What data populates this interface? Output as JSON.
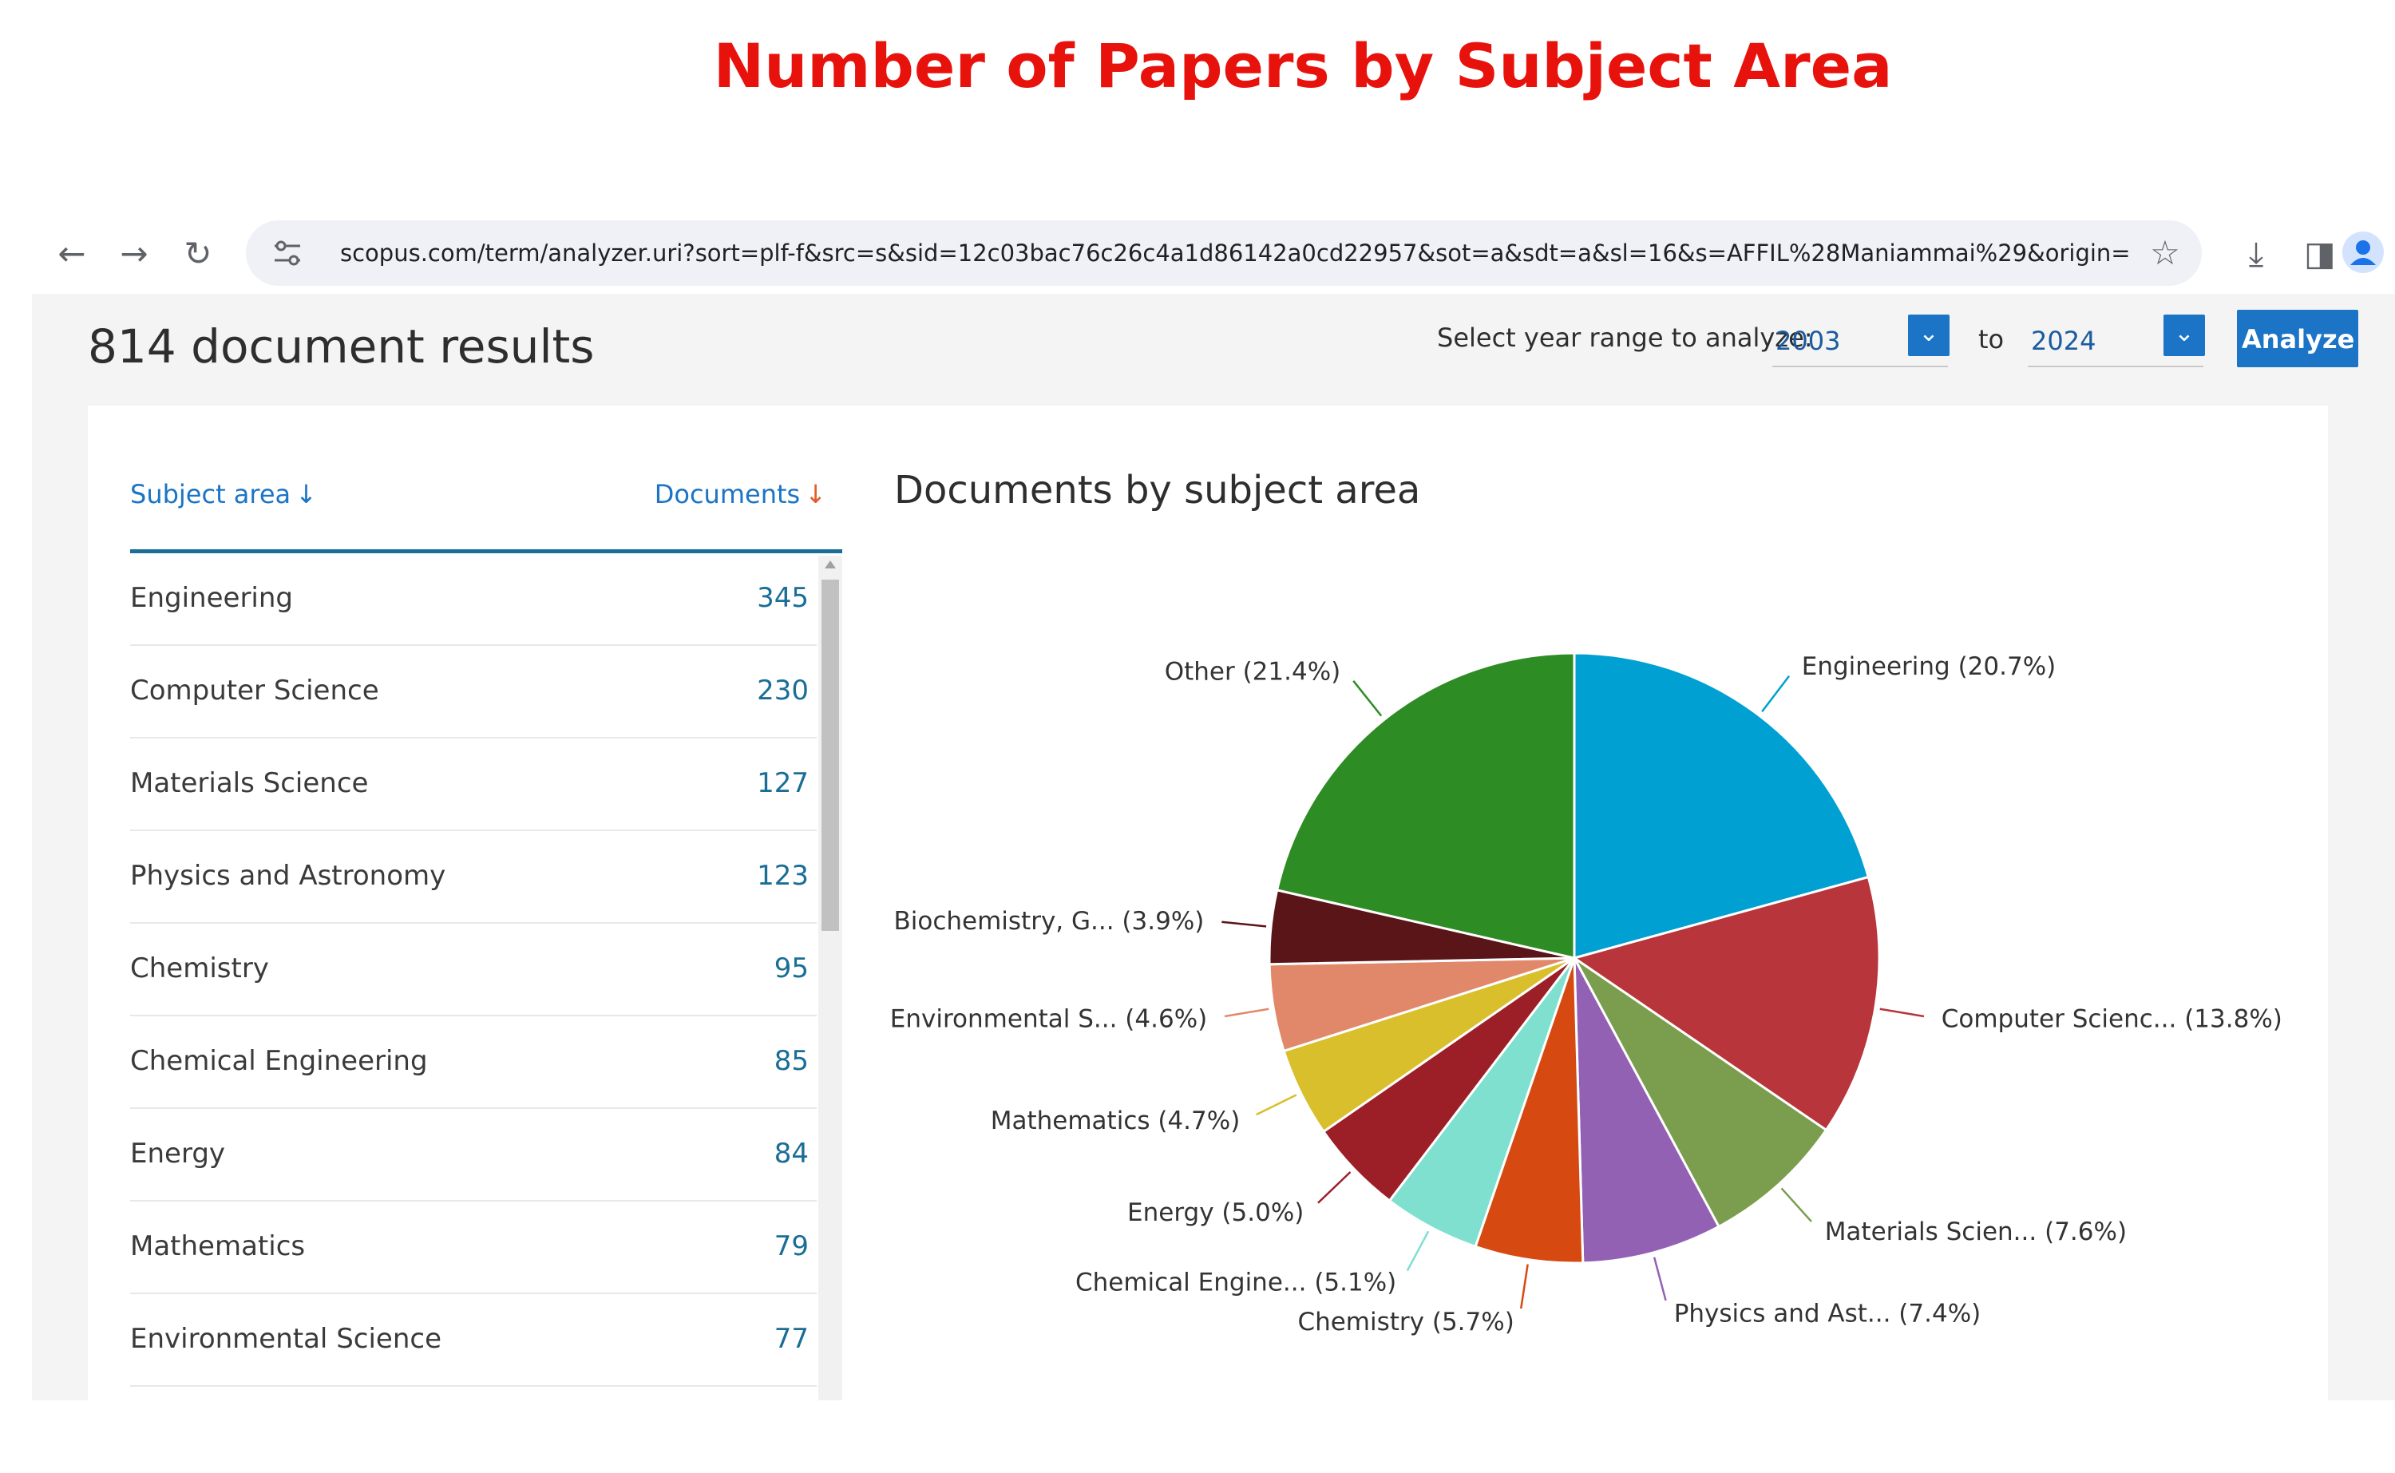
{
  "slide_title": "Number of Papers by Subject Area",
  "browser": {
    "url": "scopus.com/term/analyzer.uri?sort=plf-f&src=s&sid=12c03bac76c26c4a1d86142a0cd22957&sot=a&sdt=a&sl=16&s=AFFIL%28Maniammai%29&origin=resultslis...",
    "back_icon": "←",
    "forward_icon": "→",
    "reload_icon": "↻",
    "star_icon": "☆",
    "download_icon": "⤓",
    "sidebar_icon": "◨",
    "profile_icon": "●"
  },
  "header": {
    "results_title": "814 document results",
    "year_label": "Select year range to analyze:",
    "year_from": "2003",
    "to_label": "to",
    "year_to": "2024",
    "analyze_label": "Analyze"
  },
  "table": {
    "col_subject": "Subject area",
    "col_documents": "Documents",
    "sort_icon": "↓",
    "rows": [
      {
        "name": "Engineering",
        "count": "345"
      },
      {
        "name": "Computer Science",
        "count": "230"
      },
      {
        "name": "Materials Science",
        "count": "127"
      },
      {
        "name": "Physics and Astronomy",
        "count": "123"
      },
      {
        "name": "Chemistry",
        "count": "95"
      },
      {
        "name": "Chemical Engineering",
        "count": "85"
      },
      {
        "name": "Energy",
        "count": "84"
      },
      {
        "name": "Mathematics",
        "count": "79"
      },
      {
        "name": "Environmental Science",
        "count": "77"
      }
    ]
  },
  "chart_data": {
    "type": "pie",
    "title": "Documents by subject area",
    "slices": [
      {
        "label": "Engineering (20.7%)",
        "value": 20.7,
        "color": "#00a0d2"
      },
      {
        "label": "Computer Scienc... (13.8%)",
        "value": 13.8,
        "color": "#b7353b"
      },
      {
        "label": "Materials Scien... (7.6%)",
        "value": 7.6,
        "color": "#7a9e4d"
      },
      {
        "label": "Physics and Ast... (7.4%)",
        "value": 7.4,
        "color": "#9361b3"
      },
      {
        "label": "Chemistry (5.7%)",
        "value": 5.7,
        "color": "#d64a12"
      },
      {
        "label": "Chemical Engine... (5.1%)",
        "value": 5.1,
        "color": "#7fe0d0"
      },
      {
        "label": "Energy (5.0%)",
        "value": 5.0,
        "color": "#9c1f27"
      },
      {
        "label": "Mathematics (4.7%)",
        "value": 4.7,
        "color": "#d8bf2b"
      },
      {
        "label": "Environmental S... (4.6%)",
        "value": 4.6,
        "color": "#e2886a"
      },
      {
        "label": "Biochemistry, G... (3.9%)",
        "value": 3.9,
        "color": "#5a1519"
      },
      {
        "label": "Other (21.4%)",
        "value": 21.4,
        "color": "#2e8c24"
      }
    ]
  }
}
